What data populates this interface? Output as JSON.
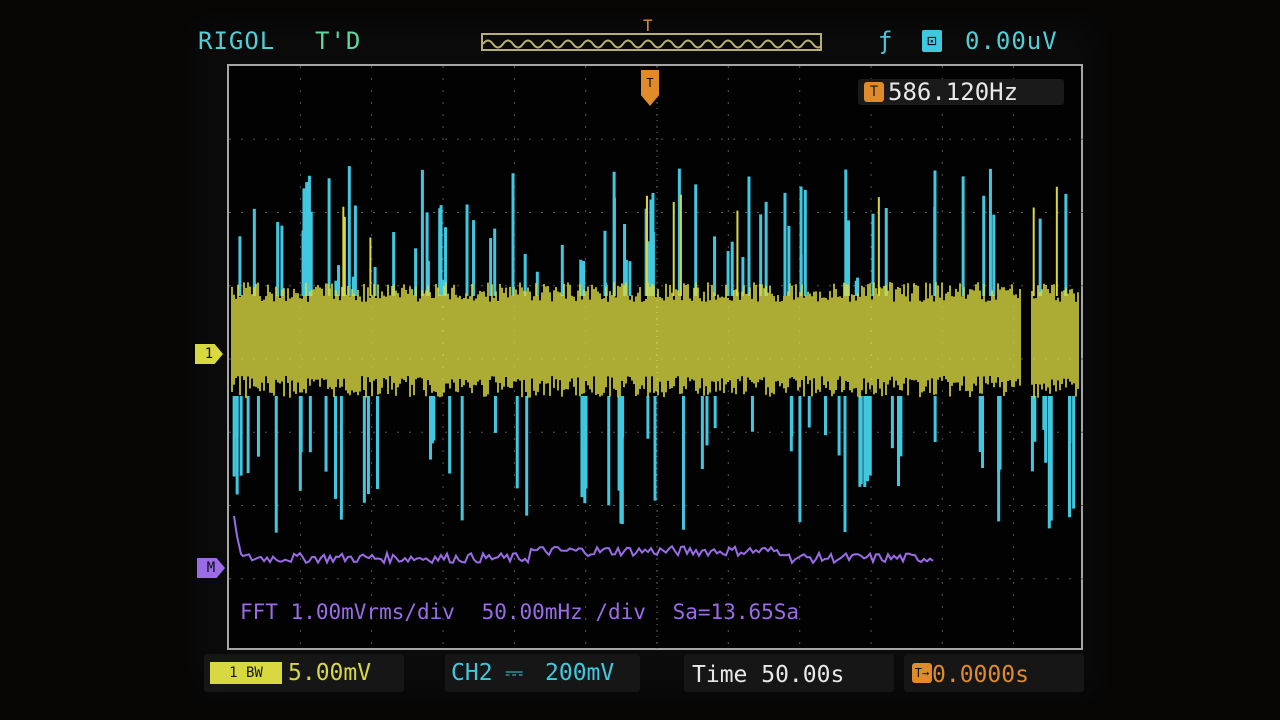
{
  "header": {
    "brand": "RIGOL",
    "trigger_status": "T'D",
    "trigger_level": "0.00uV",
    "trigger_edge_icon": "rising-edge-icon",
    "trigger_source_icon": "ac-source-icon"
  },
  "measurement": {
    "frequency": "586.120Hz",
    "icon": "trigger-frequency-icon"
  },
  "fft": {
    "scale": "FFT 1.00mVrms/div",
    "freq_scale": "50.00mHz /div",
    "sample_rate": "Sa=13.65Sa"
  },
  "status_bar": {
    "ch1_scale": "5.00mV",
    "ch2_label": "CH2",
    "ch2_scale": "200mV",
    "timebase": "Time 50.00s",
    "trigger_delay": "0.0000s"
  },
  "colors": {
    "ch1": "#d8d840",
    "ch2": "#40c8e0",
    "math": "#9a6ce8",
    "trigger": "#e08a2a"
  }
}
